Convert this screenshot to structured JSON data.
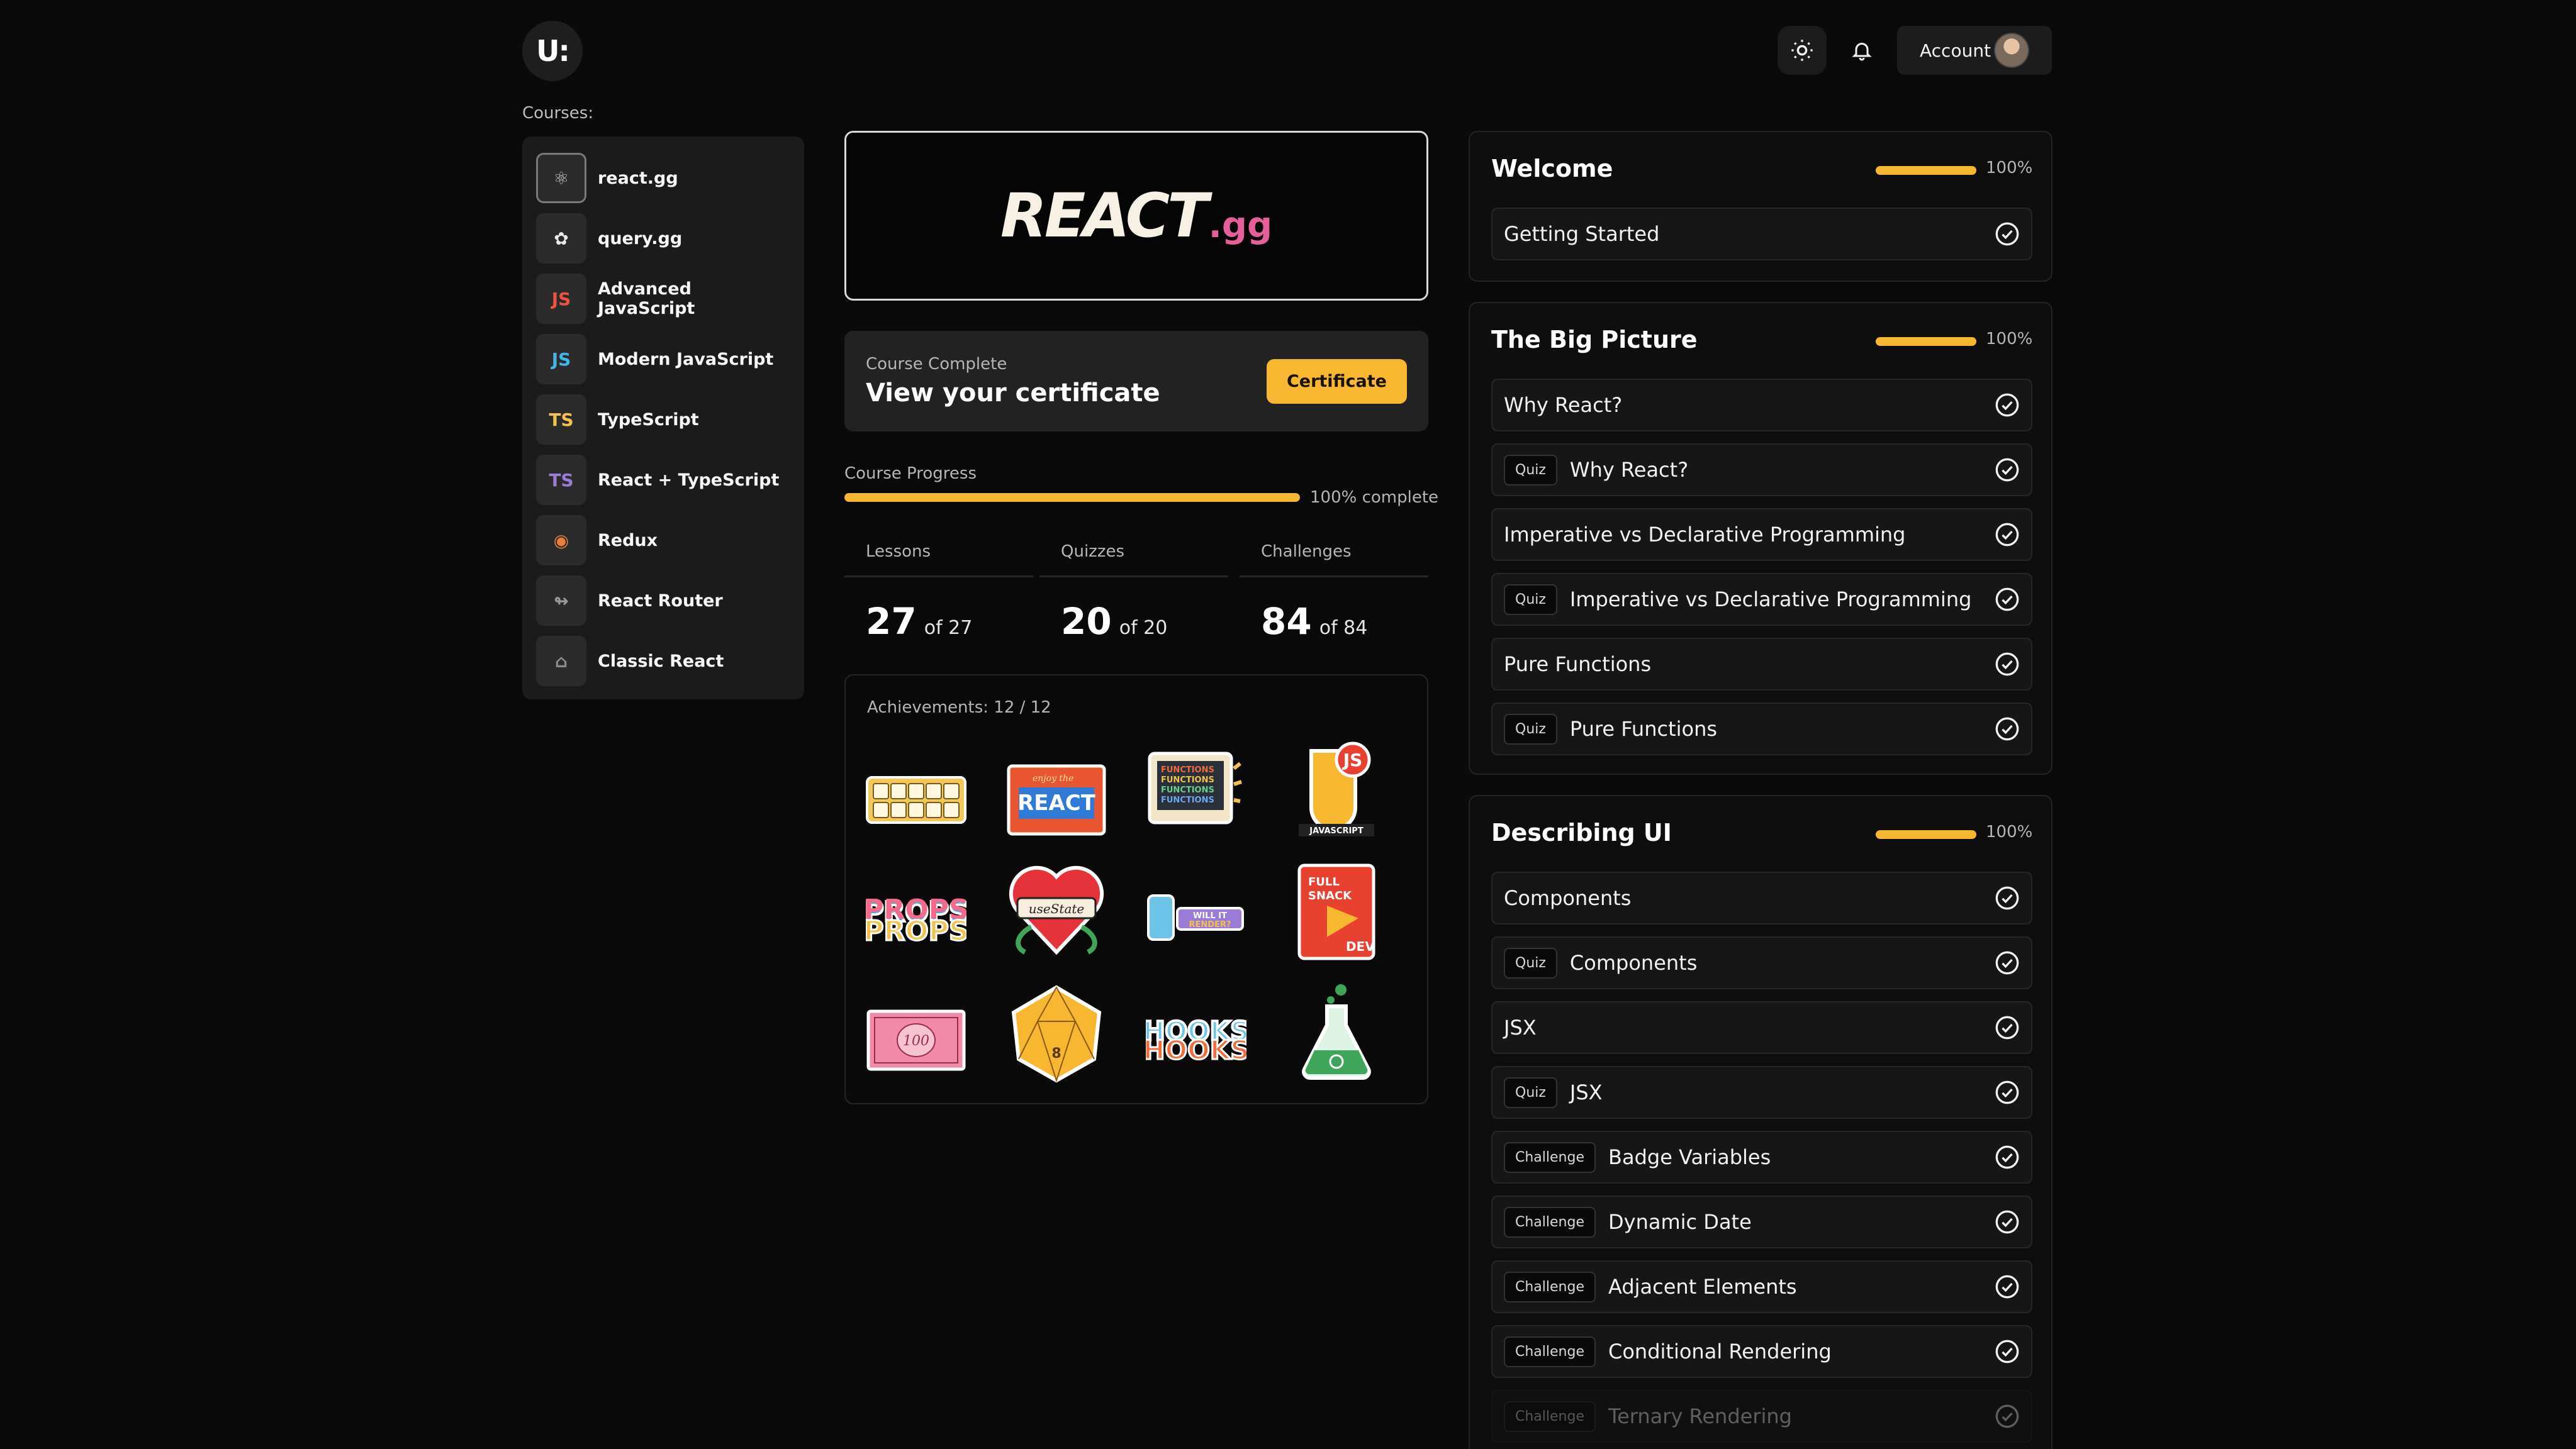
{
  "header": {
    "logo_text": "U:",
    "theme_icon": "sun-icon",
    "notifications_icon": "bell-icon",
    "account_label": "Account"
  },
  "sidebar": {
    "title": "Courses:",
    "items": [
      {
        "label": "react.gg",
        "icon": "react-gg-icon",
        "icon_glyph": "⚛",
        "color": "#c9c9c9",
        "active": true
      },
      {
        "label": "query.gg",
        "icon": "query-gg-icon",
        "icon_glyph": "✿",
        "color": "#e8e8e8",
        "active": false
      },
      {
        "label": "Advanced JavaScript",
        "icon": "advanced-js-icon",
        "icon_glyph": "JS",
        "color": "#f0533b",
        "active": false
      },
      {
        "label": "Modern JavaScript",
        "icon": "modern-js-icon",
        "icon_glyph": "JS",
        "color": "#3fb7e8",
        "active": false
      },
      {
        "label": "TypeScript",
        "icon": "typescript-icon",
        "icon_glyph": "TS",
        "color": "#f2c14e",
        "active": false
      },
      {
        "label": "React + TypeScript",
        "icon": "react-typescript-icon",
        "icon_glyph": "TS",
        "color": "#9a7bd8",
        "active": false
      },
      {
        "label": "Redux",
        "icon": "redux-icon",
        "icon_glyph": "◉",
        "color": "#e97e3a",
        "active": false
      },
      {
        "label": "React Router",
        "icon": "react-router-icon",
        "icon_glyph": "↬",
        "color": "#9a9a9a",
        "active": false
      },
      {
        "label": "Classic React",
        "icon": "classic-react-icon",
        "icon_glyph": "⌂",
        "color": "#8a8a8a",
        "active": false
      }
    ]
  },
  "brand": {
    "main": "REACT",
    "suffix": ".gg"
  },
  "certificate": {
    "status": "Course Complete",
    "headline": "View your certificate",
    "button": "Certificate"
  },
  "progress": {
    "label": "Course Progress",
    "value": 1.0,
    "text": "100% complete"
  },
  "stats": [
    {
      "label": "Lessons",
      "value": "27",
      "of": "of 27"
    },
    {
      "label": "Quizzes",
      "value": "20",
      "of": "of 20"
    },
    {
      "label": "Challenges",
      "value": "84",
      "of": "of 84"
    }
  ],
  "achievements": {
    "title": "Achievements: 12 / 12",
    "stickers": [
      "keyboard-keys-sticker",
      "enjoy-react-sticker",
      "functions-computer-sticker",
      "javascript-sticker",
      "props-sticker",
      "use-state-heart-sticker",
      "will-it-render-sticker",
      "full-snack-dev-sticker",
      "hundred-bill-sticker",
      "dice-sticker",
      "hooks-sticker",
      "flask-sticker"
    ]
  },
  "sections": [
    {
      "title": "Welcome",
      "progress": 1.0,
      "percent": "100%",
      "lessons": [
        {
          "tag": "",
          "label": "Getting Started"
        }
      ]
    },
    {
      "title": "The Big Picture",
      "progress": 1.0,
      "percent": "100%",
      "lessons": [
        {
          "tag": "",
          "label": "Why React?"
        },
        {
          "tag": "Quiz",
          "label": "Why React?"
        },
        {
          "tag": "",
          "label": "Imperative vs Declarative Programming"
        },
        {
          "tag": "Quiz",
          "label": "Imperative vs Declarative Programming"
        },
        {
          "tag": "",
          "label": "Pure Functions"
        },
        {
          "tag": "Quiz",
          "label": "Pure Functions"
        }
      ]
    },
    {
      "title": "Describing UI",
      "progress": 1.0,
      "percent": "100%",
      "lessons": [
        {
          "tag": "",
          "label": "Components"
        },
        {
          "tag": "Quiz",
          "label": "Components"
        },
        {
          "tag": "",
          "label": "JSX"
        },
        {
          "tag": "Quiz",
          "label": "JSX"
        },
        {
          "tag": "Challenge",
          "label": "Badge Variables"
        },
        {
          "tag": "Challenge",
          "label": "Dynamic Date"
        },
        {
          "tag": "Challenge",
          "label": "Adjacent Elements"
        },
        {
          "tag": "Challenge",
          "label": "Conditional Rendering"
        },
        {
          "tag": "Challenge",
          "label": "Ternary Rendering"
        }
      ]
    }
  ]
}
